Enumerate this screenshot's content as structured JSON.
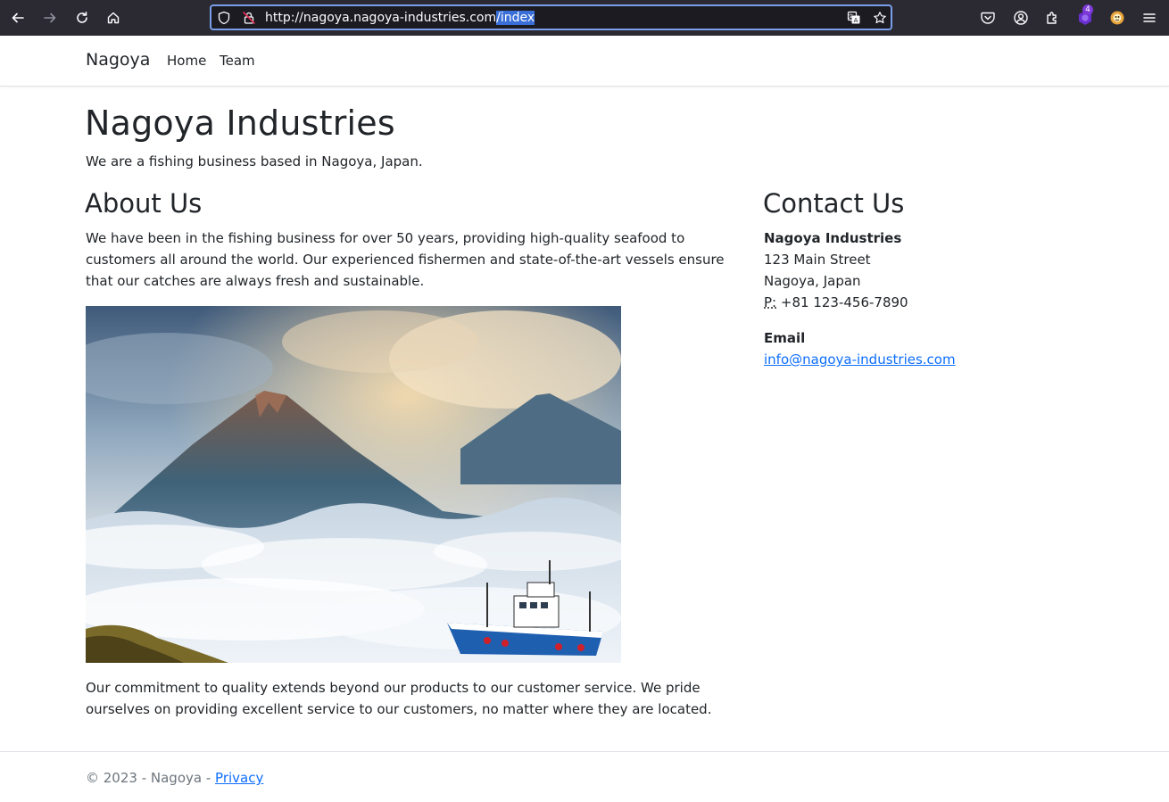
{
  "browser": {
    "url_prefix": "http://nagoya.nagoya-industries.com",
    "url_selected": "/index",
    "extension_badge": "4"
  },
  "navbar": {
    "brand": "Nagoya",
    "links": [
      "Home",
      "Team"
    ]
  },
  "main": {
    "title": "Nagoya Industries",
    "lead": "We are a fishing business based in Nagoya, Japan.",
    "about": {
      "heading": "About Us",
      "paragraph1": "We have been in the fishing business for over 50 years, providing high-quality seafood to customers all around the world. Our experienced fishermen and state-of-the-art vessels ensure that our catches are always fresh and sustainable.",
      "paragraph2": "Our commitment to quality extends beyond our products to our customer service. We pride ourselves on providing excellent service to our customers, no matter where they are located."
    },
    "contact": {
      "heading": "Contact Us",
      "company": "Nagoya Industries",
      "street": "123 Main Street",
      "city": "Nagoya, Japan",
      "phone_label": "P:",
      "phone": "+81 123-456-7890",
      "email_heading": "Email",
      "email": "info@nagoya-industries.com"
    }
  },
  "footer": {
    "copyright": "© 2023 - Nagoya - ",
    "privacy": "Privacy"
  },
  "colors": {
    "link": "#0d6efd",
    "chrome_bg": "#2b2a33",
    "urlbar_bg": "#1c1b22",
    "url_focus": "#7a9ee8"
  }
}
